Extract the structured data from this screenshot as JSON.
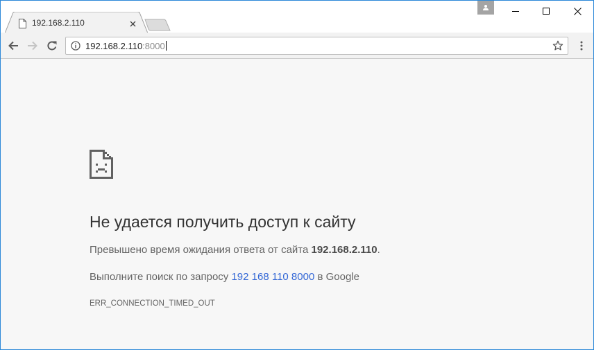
{
  "tab": {
    "title": "192.168.2.110",
    "favicon": "page-icon",
    "close_icon": "close-icon"
  },
  "window_controls": {
    "profile_icon": "person-icon",
    "minimize_icon": "minimize-icon",
    "maximize_icon": "maximize-icon",
    "close_icon": "close-icon"
  },
  "toolbar": {
    "back_icon": "arrow-left-icon",
    "forward_icon": "arrow-right-icon",
    "reload_icon": "reload-icon",
    "menu_icon": "kebab-menu-icon"
  },
  "omnibox": {
    "security_icon": "info-icon",
    "url_host": "192.168.2.110",
    "url_port": ":8000",
    "bookmark_icon": "star-icon"
  },
  "error_page": {
    "icon": "sad-page-icon",
    "heading": "Не удается получить доступ к сайту",
    "line1_prefix": "Превышено время ожидания ответа от сайта ",
    "line1_host": "192.168.2.110",
    "line1_suffix": ".",
    "line2_prefix": "Выполните поиск по запросу ",
    "line2_link": "192 168 110 8000",
    "line2_suffix": " в Google",
    "error_code": "ERR_CONNECTION_TIMED_OUT"
  },
  "colors": {
    "accent_link": "#3367d6",
    "window_border": "#2b88d8",
    "page_background": "#f7f7f7"
  }
}
